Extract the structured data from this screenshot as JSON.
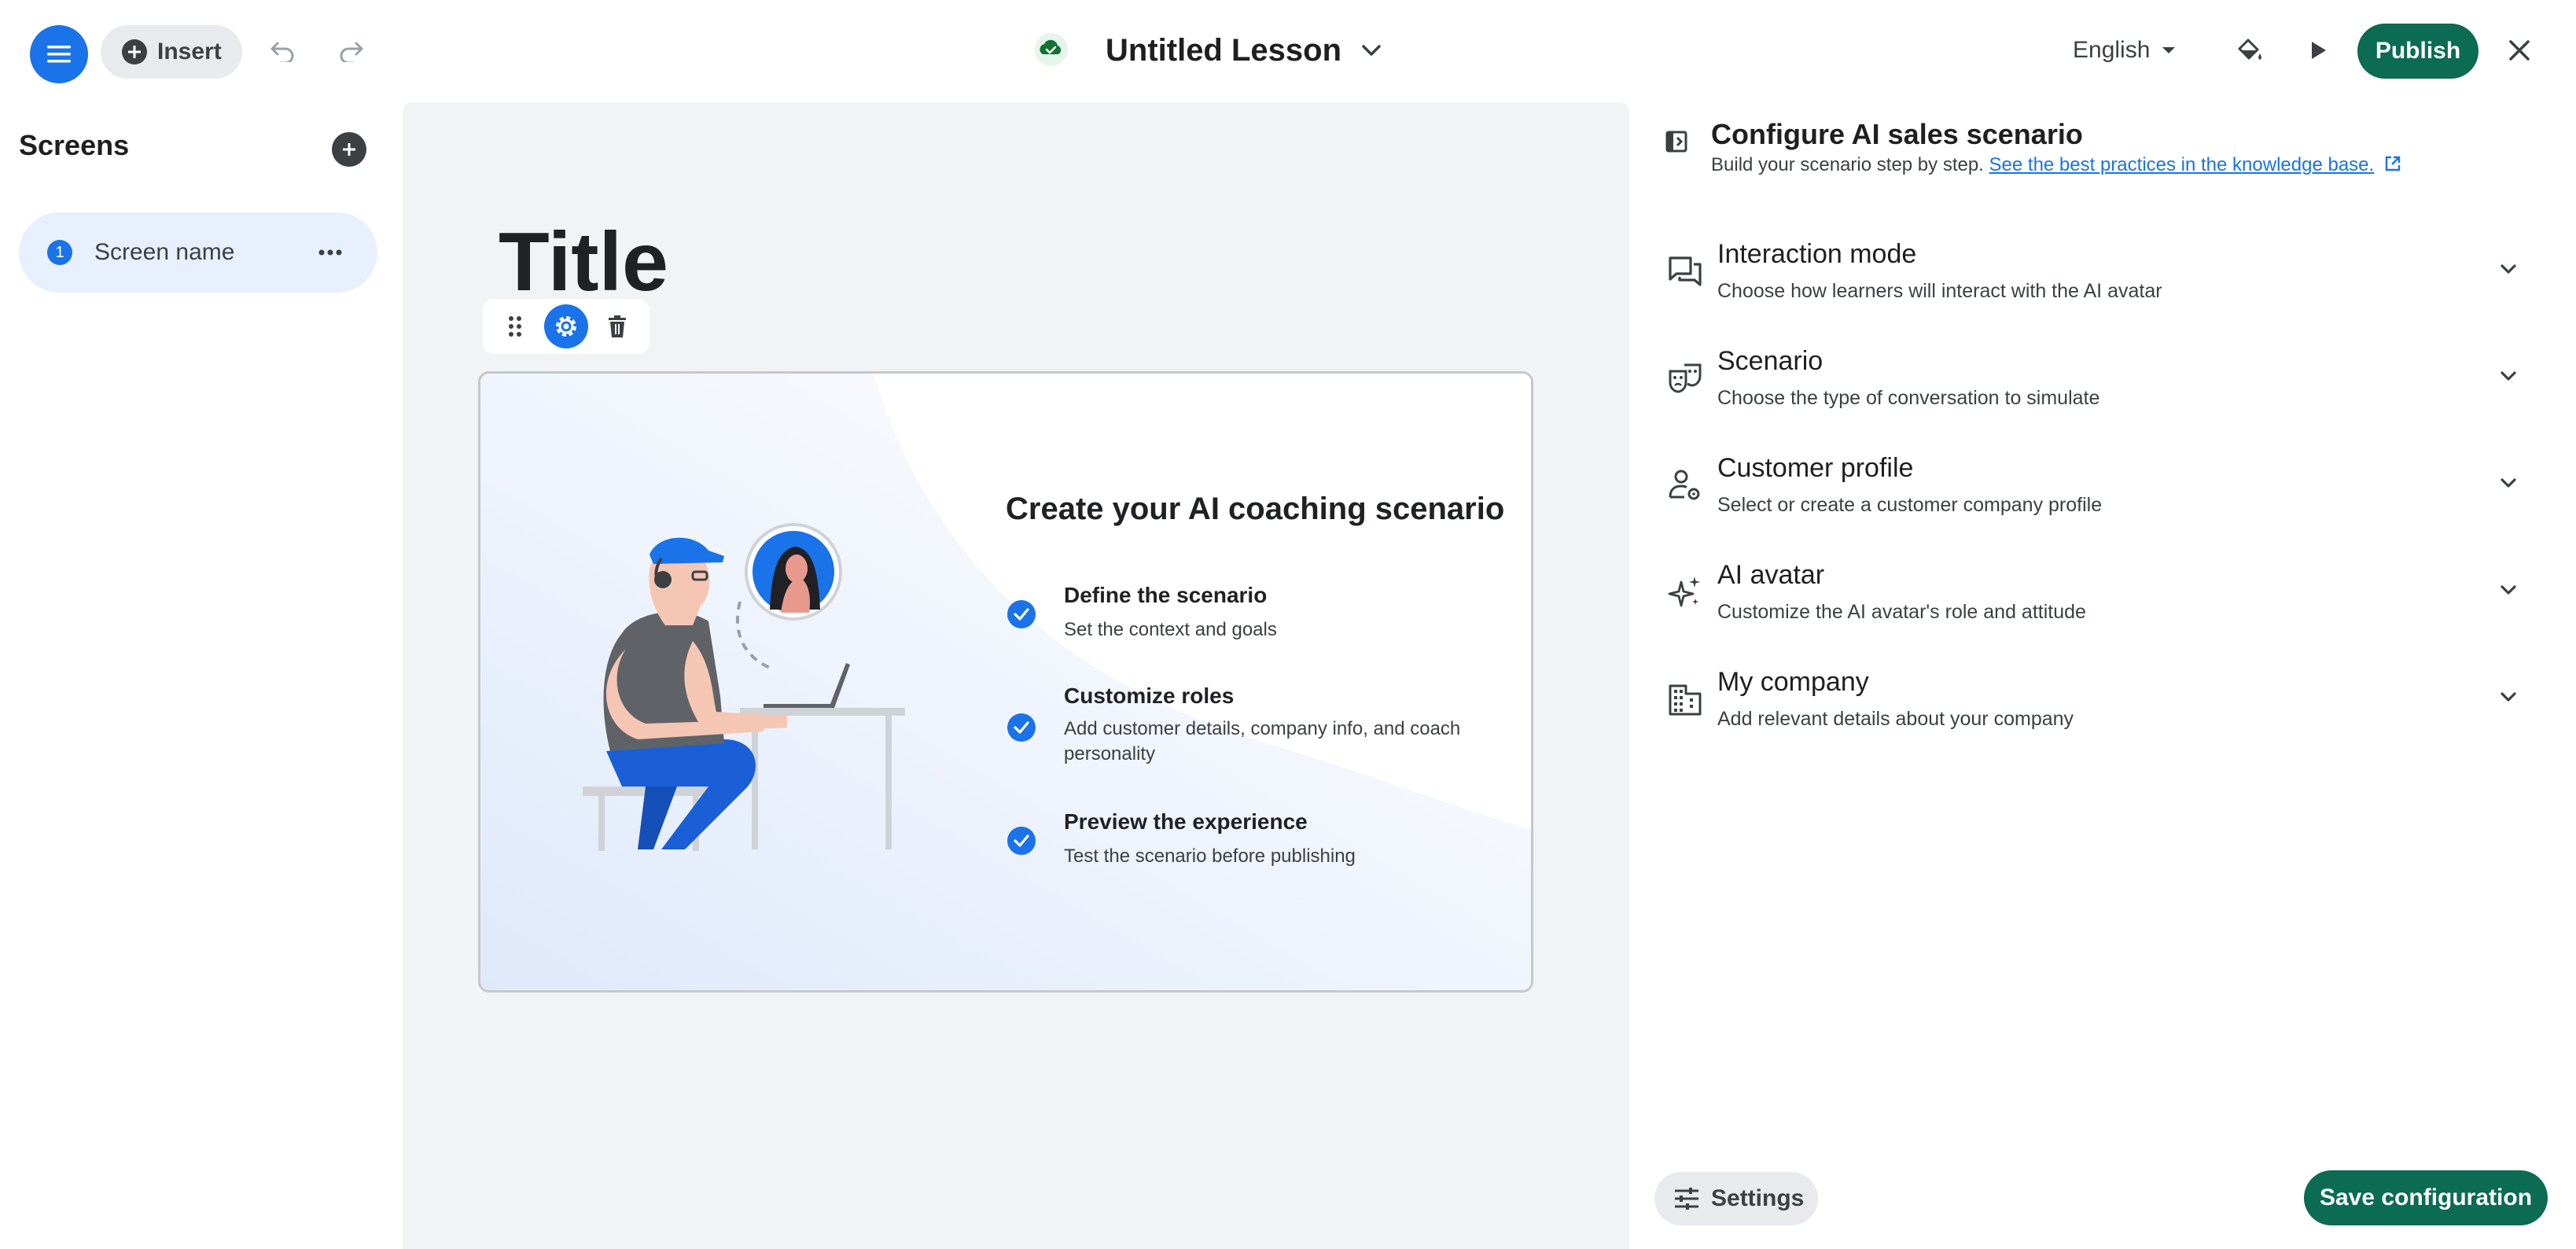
{
  "header": {
    "insert_label": "Insert",
    "lesson_title": "Untitled Lesson",
    "language": "English",
    "publish_label": "Publish",
    "save_status_icon": "cloud-check-icon"
  },
  "sidebar": {
    "title": "Screens",
    "screens": [
      {
        "number": "1",
        "name": "Screen name"
      }
    ]
  },
  "canvas": {
    "title": "Title",
    "card": {
      "heading": "Create your AI coaching scenario",
      "steps": [
        {
          "title": "Define the scenario",
          "desc": "Set the context and goals"
        },
        {
          "title": "Customize roles",
          "desc": "Add customer details, company info, and coach personality"
        },
        {
          "title": "Preview the experience",
          "desc": "Test the scenario before publishing"
        }
      ]
    }
  },
  "panel": {
    "title": "Configure AI sales scenario",
    "subtitle": "Build your scenario step by step.",
    "link_text": "See the best practices in the knowledge base.",
    "sections": [
      {
        "title": "Interaction mode",
        "desc": "Choose how learners will interact with the AI avatar",
        "icon": "chat-bubbles-icon"
      },
      {
        "title": "Scenario",
        "desc": "Choose the type of conversation to simulate",
        "icon": "theater-masks-icon"
      },
      {
        "title": "Customer profile",
        "desc": "Select or create a customer company profile",
        "icon": "person-settings-icon"
      },
      {
        "title": "AI avatar",
        "desc": "Customize the AI avatar's role and attitude",
        "icon": "sparkles-icon"
      },
      {
        "title": "My company",
        "desc": "Add relevant details about your company",
        "icon": "building-icon"
      }
    ],
    "settings_label": "Settings",
    "save_label": "Save configuration"
  },
  "colors": {
    "primary_blue": "#1a73e8",
    "publish_green": "#0b6b53",
    "canvas_bg": "#f1f3f4",
    "selected_screen_bg": "#e8f0fe"
  }
}
